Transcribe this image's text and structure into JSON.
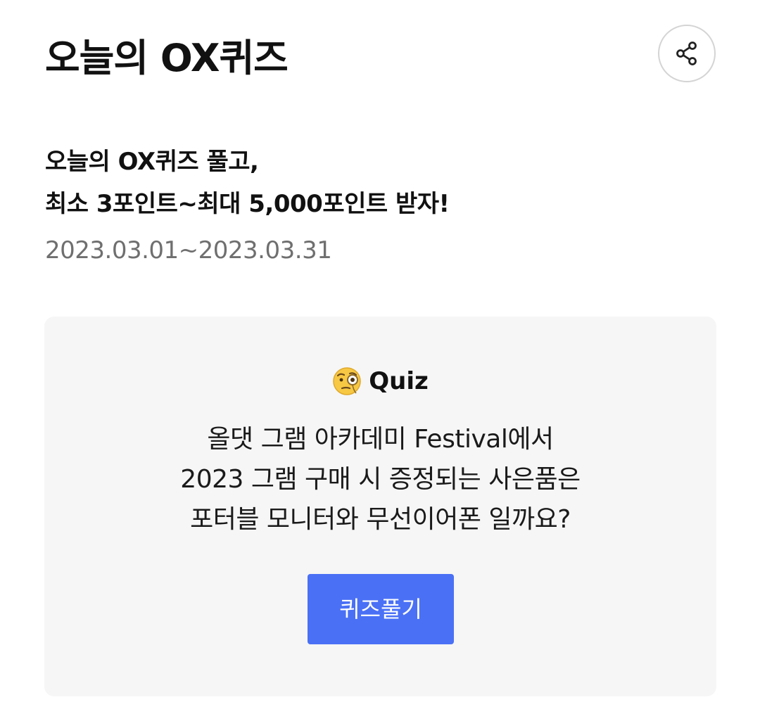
{
  "header": {
    "title": "오늘의 OX퀴즈",
    "share_icon": "share-icon"
  },
  "event": {
    "headline_line1": "오늘의 OX퀴즈 풀고,",
    "headline_line2": "최소 3포인트~최대 5,000포인트 받자!",
    "period": "2023.03.01~2023.03.31"
  },
  "quiz": {
    "label_icon": "face-with-monocle-icon",
    "label": "Quiz",
    "question_line1": "올댓 그램 아카데미 Festival에서",
    "question_line2": "2023 그램 구매 시 증정되는 사은품은",
    "question_line3": "포터블 모니터와 무선이어폰 일까요?",
    "button_label": "퀴즈풀기"
  },
  "colors": {
    "accent": "#4a70f5",
    "card_background": "#f6f6f6",
    "muted_text": "#6f6f6f"
  }
}
